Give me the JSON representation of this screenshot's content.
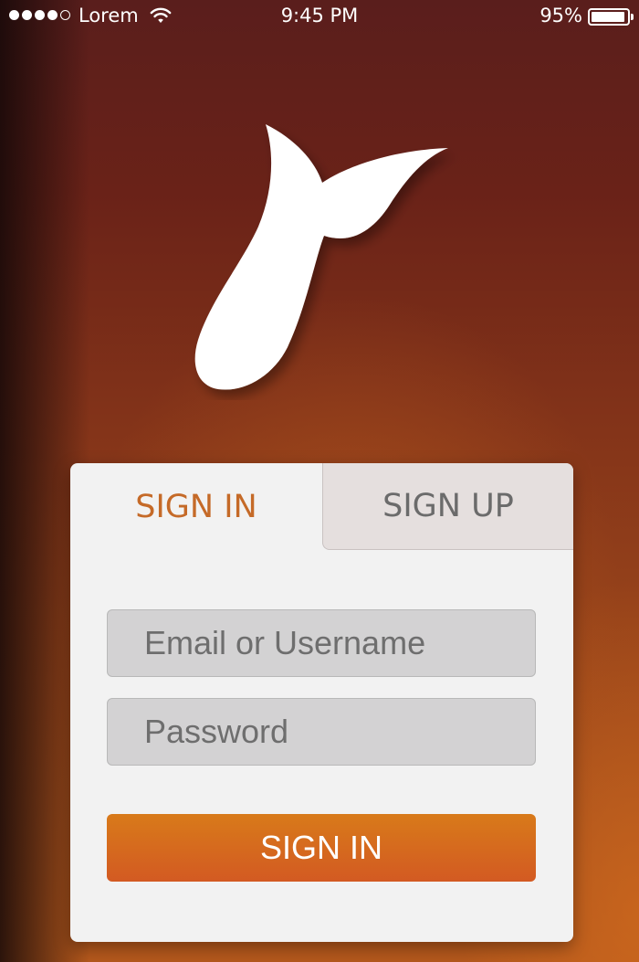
{
  "status_bar": {
    "carrier": "Lorem",
    "time": "9:45 PM",
    "battery": "95%",
    "battery_level": 0.95,
    "signal_bars_filled": 4,
    "signal_bars_total": 5
  },
  "logo": {
    "icon": "leaf-logo-icon",
    "color": "#ffffff"
  },
  "tabs": {
    "signin_label": "SIGN IN",
    "signup_label": "SIGN UP",
    "active": "signin"
  },
  "form": {
    "email_placeholder": "Email or Username",
    "email_value": "",
    "password_placeholder": "Password",
    "password_value": "",
    "submit_label": "SIGN IN"
  },
  "colors": {
    "accent": "#c56a28",
    "button_top": "#d87a1a",
    "button_bottom": "#d35a22",
    "background_top": "#5a1e1c",
    "background_bottom": "#b4581c"
  }
}
